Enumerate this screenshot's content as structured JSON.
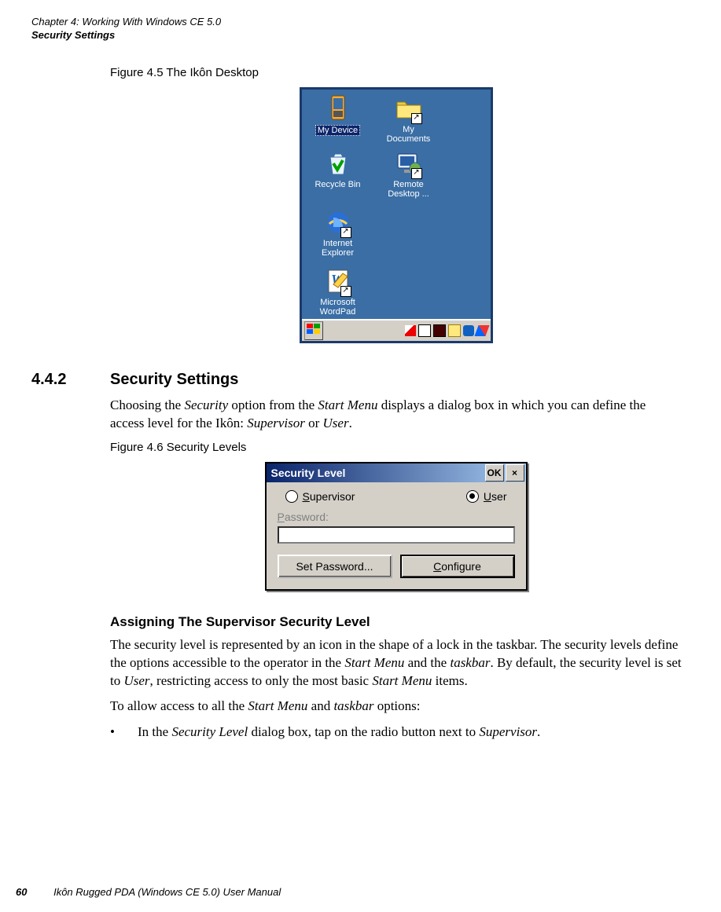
{
  "running_head": {
    "line1": "Chapter 4:  Working With Windows CE 5.0",
    "line2": "Security Settings"
  },
  "figure45": {
    "caption": "Figure 4.5  The Ikôn Desktop",
    "icons": {
      "my_device": "My Device",
      "my_documents_l1": "My",
      "my_documents_l2": "Documents",
      "recycle_bin": "Recycle Bin",
      "remote_l1": "Remote",
      "remote_l2": "Desktop ...",
      "ie_l1": "Internet",
      "ie_l2": "Explorer",
      "wordpad_l1": "Microsoft",
      "wordpad_l2": "WordPad"
    }
  },
  "section": {
    "num": "4.4.2",
    "title": "Security Settings",
    "para1_a": "Choosing the ",
    "para1_b": "Security",
    "para1_c": " option from the ",
    "para1_d": "Start Menu",
    "para1_e": " displays a dialog box in which you can define the access level for the Ikôn: ",
    "para1_f": "Supervisor",
    "para1_g": " or ",
    "para1_h": "User",
    "para1_i": "."
  },
  "figure46": {
    "caption": "Figure 4.6  Security Levels",
    "title": "Security Level",
    "ok": "OK",
    "close": "×",
    "radio_supervisor": "Supervisor",
    "radio_user": "User",
    "password_label": "Password:",
    "btn_setpw": "Set Password...",
    "btn_configure": "Configure"
  },
  "subsection": {
    "title": "Assigning The Supervisor Security Level",
    "p1_a": "The security level is represented by an icon in the shape of a lock in the taskbar. The security levels define the options accessible to the operator in the ",
    "p1_b": "Start Menu",
    "p1_c": " and the ",
    "p1_d": "taskbar",
    "p1_e": ". By default, the security level is set to ",
    "p1_f": "User",
    "p1_g": ", restricting access to only the most basic ",
    "p1_h": "Start Menu",
    "p1_i": " items.",
    "p2_a": "To allow access to all the ",
    "p2_b": "Start Menu",
    "p2_c": " and ",
    "p2_d": "taskbar",
    "p2_e": " options:",
    "bullet_a": "In the ",
    "bullet_b": "Security Level",
    "bullet_c": " dialog box, tap on the radio button next to ",
    "bullet_d": "Supervisor",
    "bullet_e": "."
  },
  "footer": {
    "page": "60",
    "title": "Ikôn Rugged PDA (Windows CE 5.0) User Manual"
  }
}
